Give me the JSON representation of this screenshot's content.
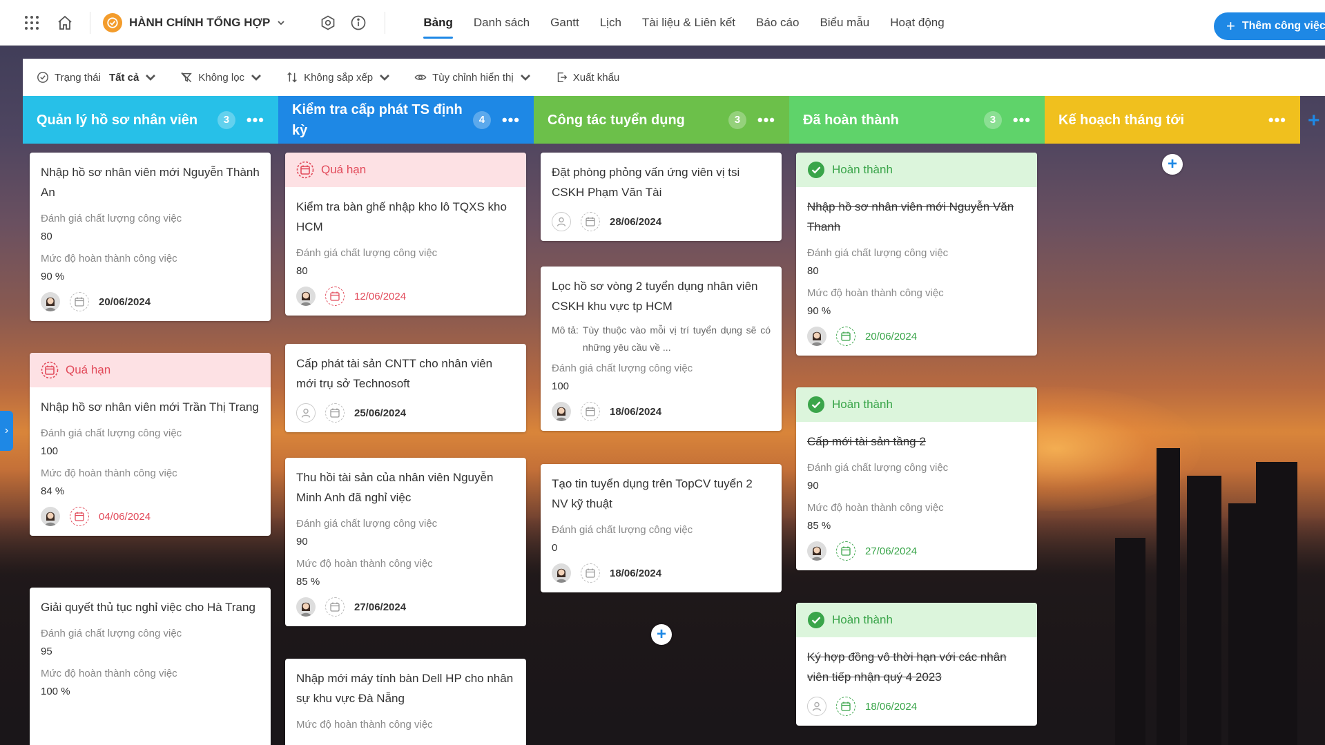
{
  "header": {
    "workspace": "HÀNH CHÍNH TỔNG HỢP",
    "tabs": [
      {
        "label": "Bảng",
        "active": true
      },
      {
        "label": "Danh sách"
      },
      {
        "label": "Gantt"
      },
      {
        "label": "Lịch"
      },
      {
        "label": "Tài liệu & Liên kết"
      },
      {
        "label": "Báo cáo"
      },
      {
        "label": "Biểu mẫu"
      },
      {
        "label": "Hoạt động"
      }
    ],
    "add_task": "Thêm công việc"
  },
  "filters": {
    "status_label": "Trạng thái",
    "status_value": "Tất cả",
    "filter_label": "Không lọc",
    "sort_label": "Không sắp xếp",
    "display_label": "Tùy chỉnh hiển thị",
    "export_label": "Xuất khẩu"
  },
  "colors": {
    "col1": "#27c0e8",
    "col2": "#1e88e5",
    "col3": "#6cc04a",
    "col4": "#5fd36a",
    "col5": "#f0c01e",
    "overdue": "#e24a5a",
    "done": "#3aa54a"
  },
  "columns": [
    {
      "title": "Quản lý hồ sơ nhân viên",
      "count": "3"
    },
    {
      "title": "Kiểm tra cấp phát TS định kỳ",
      "count": "4"
    },
    {
      "title": "Công tác tuyển dụng",
      "count": "3"
    },
    {
      "title": "Đã hoàn thành",
      "count": "3"
    },
    {
      "title": "Kế hoạch tháng tới",
      "count": ""
    }
  ],
  "labels": {
    "quality": "Đánh giá chất lượng công việc",
    "completion": "Mức độ hoàn thành công việc",
    "overdue": "Quá hạn",
    "done": "Hoàn thành",
    "desc_label": "Mô tả:"
  },
  "cards": {
    "c1_1": {
      "title": "Nhập hồ sơ nhân viên mới Nguyễn Thành An",
      "quality": "80",
      "completion": "90 %",
      "date": "20/06/2024"
    },
    "c1_2": {
      "title": "Nhập hồ sơ nhân viên mới Trần Thị Trang",
      "quality": "100",
      "completion": "84 %",
      "date": "04/06/2024"
    },
    "c1_3": {
      "title": "Giải quyết thủ tục nghỉ việc cho Hà Trang",
      "quality": "95",
      "completion": "100 %"
    },
    "c2_1": {
      "title": "Kiểm tra bàn ghế nhập kho lô TQXS kho HCM",
      "quality": "80",
      "date": "12/06/2024"
    },
    "c2_2": {
      "title": "Cấp phát tài sản CNTT cho nhân viên mới trụ sở Technosoft",
      "date": "25/06/2024"
    },
    "c2_3": {
      "title": "Thu hồi tài sản của nhân viên Nguyễn Minh Anh đã nghỉ việc",
      "quality": "90",
      "completion": "85 %",
      "date": "27/06/2024"
    },
    "c2_4": {
      "title": "Nhập mới máy tính bàn Dell HP cho nhân sự khu vực Đà Nẵng"
    },
    "c3_1": {
      "title": "Đặt phòng phỏng vấn ứng viên vị tsi CSKH Phạm Văn Tài",
      "date": "28/06/2024"
    },
    "c3_2": {
      "title": "Lọc hồ sơ vòng 2 tuyển dụng nhân viên CSKH khu vực tp HCM",
      "desc": "Tùy thuộc vào mỗi vị trí tuyển dụng sẽ có những yêu cầu về ...",
      "quality": "100",
      "date": "18/06/2024"
    },
    "c3_3": {
      "title": "Tạo tin tuyển dụng trên TopCV tuyển 2 NV kỹ thuật",
      "quality": "0",
      "date": "18/06/2024"
    },
    "c4_1": {
      "title": "Nhập hồ sơ nhân viên mới Nguyễn Văn Thanh",
      "quality": "80",
      "completion": "90 %",
      "date": "20/06/2024"
    },
    "c4_2": {
      "title": "Cấp mới tài sản tầng 2",
      "quality": "90",
      "completion": "85 %",
      "date": "27/06/2024"
    },
    "c4_3": {
      "title": "Ký hợp đồng vô thời hạn với các nhân viên tiếp nhận quý 4 2023",
      "date": "18/06/2024"
    }
  }
}
